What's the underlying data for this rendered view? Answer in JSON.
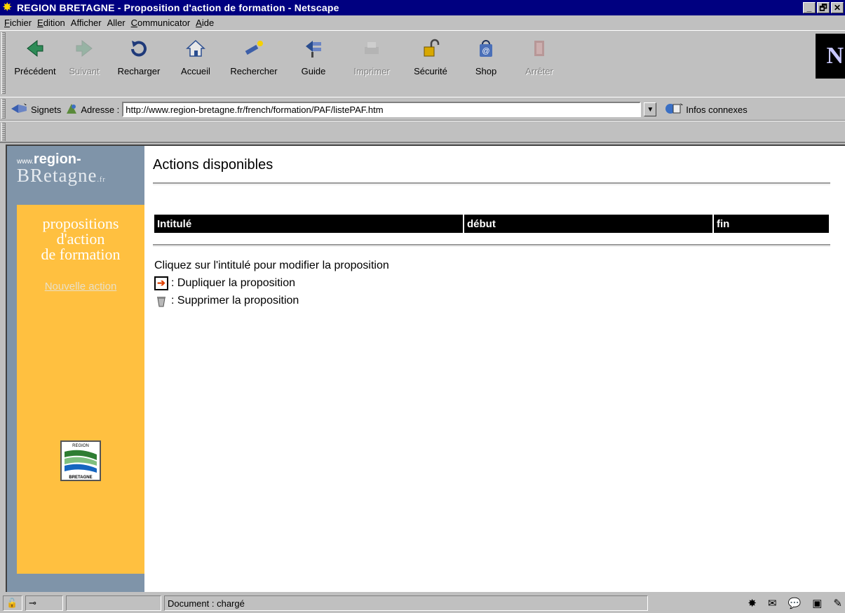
{
  "window": {
    "title": "REGION BRETAGNE - Proposition d'action de formation - Netscape",
    "buttons": [
      "_",
      "🗗",
      "✕"
    ]
  },
  "menu": [
    {
      "label": "Fichier",
      "key": "F",
      "rest": "ichier"
    },
    {
      "label": "Edition",
      "key": "E",
      "rest": "dition"
    },
    {
      "label": "Afficher",
      "key": "",
      "rest": "Afficher"
    },
    {
      "label": "Aller",
      "key": "",
      "rest": "Aller"
    },
    {
      "label": "Communicator",
      "key": "C",
      "rest": "ommunicator"
    },
    {
      "label": "Aide",
      "key": "A",
      "rest": "ide"
    }
  ],
  "toolbar": {
    "back": "Précédent",
    "forward": "Suivant",
    "reload": "Recharger",
    "home": "Accueil",
    "search": "Rechercher",
    "guide": "Guide",
    "print": "Imprimer",
    "security": "Sécurité",
    "shop": "Shop",
    "stop": "Arrêter",
    "logo": "N"
  },
  "location": {
    "bookmarks_label": "Signets",
    "address_label": "Adresse :",
    "url": "http://www.region-bretagne.fr/french/formation/PAF/listePAF.htm",
    "related_label": "Infos connexes"
  },
  "sidebar": {
    "logo_www": "www.",
    "logo_region": "region-",
    "logo_bretagne": "BRetagne",
    "logo_fr": ".fr",
    "section_line1": "propositions",
    "section_line2": "d'action",
    "section_line3": "de formation",
    "new_action_link": "Nouvelle action",
    "emblem_top": "REGION",
    "emblem_bottom": "BRETAGNE"
  },
  "main": {
    "title": "Actions disponibles",
    "columns": [
      "Intitulé",
      "début",
      "fin"
    ],
    "help_text": "Cliquez sur l'intitulé pour modifier la proposition",
    "duplicate_text": ": Dupliquer la proposition",
    "delete_text": ": Supprimer la proposition"
  },
  "status": {
    "text": "Document : chargé"
  },
  "colors": {
    "titlebar": "#000080",
    "sidebar_blue": "#7f94a9",
    "sidebar_orange": "#ffc040",
    "table_header": "#000000"
  }
}
